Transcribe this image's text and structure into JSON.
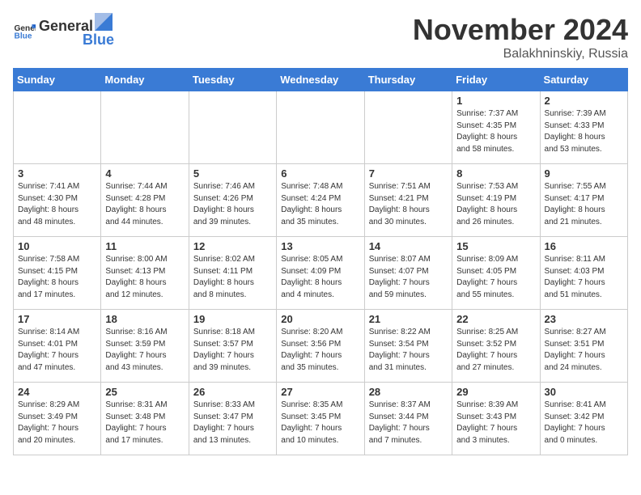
{
  "logo": {
    "general": "General",
    "blue": "Blue"
  },
  "title": "November 2024",
  "location": "Balakhninskiy, Russia",
  "days_header": [
    "Sunday",
    "Monday",
    "Tuesday",
    "Wednesday",
    "Thursday",
    "Friday",
    "Saturday"
  ],
  "weeks": [
    [
      {
        "day": "",
        "info": ""
      },
      {
        "day": "",
        "info": ""
      },
      {
        "day": "",
        "info": ""
      },
      {
        "day": "",
        "info": ""
      },
      {
        "day": "",
        "info": ""
      },
      {
        "day": "1",
        "info": "Sunrise: 7:37 AM\nSunset: 4:35 PM\nDaylight: 8 hours\nand 58 minutes."
      },
      {
        "day": "2",
        "info": "Sunrise: 7:39 AM\nSunset: 4:33 PM\nDaylight: 8 hours\nand 53 minutes."
      }
    ],
    [
      {
        "day": "3",
        "info": "Sunrise: 7:41 AM\nSunset: 4:30 PM\nDaylight: 8 hours\nand 48 minutes."
      },
      {
        "day": "4",
        "info": "Sunrise: 7:44 AM\nSunset: 4:28 PM\nDaylight: 8 hours\nand 44 minutes."
      },
      {
        "day": "5",
        "info": "Sunrise: 7:46 AM\nSunset: 4:26 PM\nDaylight: 8 hours\nand 39 minutes."
      },
      {
        "day": "6",
        "info": "Sunrise: 7:48 AM\nSunset: 4:24 PM\nDaylight: 8 hours\nand 35 minutes."
      },
      {
        "day": "7",
        "info": "Sunrise: 7:51 AM\nSunset: 4:21 PM\nDaylight: 8 hours\nand 30 minutes."
      },
      {
        "day": "8",
        "info": "Sunrise: 7:53 AM\nSunset: 4:19 PM\nDaylight: 8 hours\nand 26 minutes."
      },
      {
        "day": "9",
        "info": "Sunrise: 7:55 AM\nSunset: 4:17 PM\nDaylight: 8 hours\nand 21 minutes."
      }
    ],
    [
      {
        "day": "10",
        "info": "Sunrise: 7:58 AM\nSunset: 4:15 PM\nDaylight: 8 hours\nand 17 minutes."
      },
      {
        "day": "11",
        "info": "Sunrise: 8:00 AM\nSunset: 4:13 PM\nDaylight: 8 hours\nand 12 minutes."
      },
      {
        "day": "12",
        "info": "Sunrise: 8:02 AM\nSunset: 4:11 PM\nDaylight: 8 hours\nand 8 minutes."
      },
      {
        "day": "13",
        "info": "Sunrise: 8:05 AM\nSunset: 4:09 PM\nDaylight: 8 hours\nand 4 minutes."
      },
      {
        "day": "14",
        "info": "Sunrise: 8:07 AM\nSunset: 4:07 PM\nDaylight: 7 hours\nand 59 minutes."
      },
      {
        "day": "15",
        "info": "Sunrise: 8:09 AM\nSunset: 4:05 PM\nDaylight: 7 hours\nand 55 minutes."
      },
      {
        "day": "16",
        "info": "Sunrise: 8:11 AM\nSunset: 4:03 PM\nDaylight: 7 hours\nand 51 minutes."
      }
    ],
    [
      {
        "day": "17",
        "info": "Sunrise: 8:14 AM\nSunset: 4:01 PM\nDaylight: 7 hours\nand 47 minutes."
      },
      {
        "day": "18",
        "info": "Sunrise: 8:16 AM\nSunset: 3:59 PM\nDaylight: 7 hours\nand 43 minutes."
      },
      {
        "day": "19",
        "info": "Sunrise: 8:18 AM\nSunset: 3:57 PM\nDaylight: 7 hours\nand 39 minutes."
      },
      {
        "day": "20",
        "info": "Sunrise: 8:20 AM\nSunset: 3:56 PM\nDaylight: 7 hours\nand 35 minutes."
      },
      {
        "day": "21",
        "info": "Sunrise: 8:22 AM\nSunset: 3:54 PM\nDaylight: 7 hours\nand 31 minutes."
      },
      {
        "day": "22",
        "info": "Sunrise: 8:25 AM\nSunset: 3:52 PM\nDaylight: 7 hours\nand 27 minutes."
      },
      {
        "day": "23",
        "info": "Sunrise: 8:27 AM\nSunset: 3:51 PM\nDaylight: 7 hours\nand 24 minutes."
      }
    ],
    [
      {
        "day": "24",
        "info": "Sunrise: 8:29 AM\nSunset: 3:49 PM\nDaylight: 7 hours\nand 20 minutes."
      },
      {
        "day": "25",
        "info": "Sunrise: 8:31 AM\nSunset: 3:48 PM\nDaylight: 7 hours\nand 17 minutes."
      },
      {
        "day": "26",
        "info": "Sunrise: 8:33 AM\nSunset: 3:47 PM\nDaylight: 7 hours\nand 13 minutes."
      },
      {
        "day": "27",
        "info": "Sunrise: 8:35 AM\nSunset: 3:45 PM\nDaylight: 7 hours\nand 10 minutes."
      },
      {
        "day": "28",
        "info": "Sunrise: 8:37 AM\nSunset: 3:44 PM\nDaylight: 7 hours\nand 7 minutes."
      },
      {
        "day": "29",
        "info": "Sunrise: 8:39 AM\nSunset: 3:43 PM\nDaylight: 7 hours\nand 3 minutes."
      },
      {
        "day": "30",
        "info": "Sunrise: 8:41 AM\nSunset: 3:42 PM\nDaylight: 7 hours\nand 0 minutes."
      }
    ]
  ]
}
